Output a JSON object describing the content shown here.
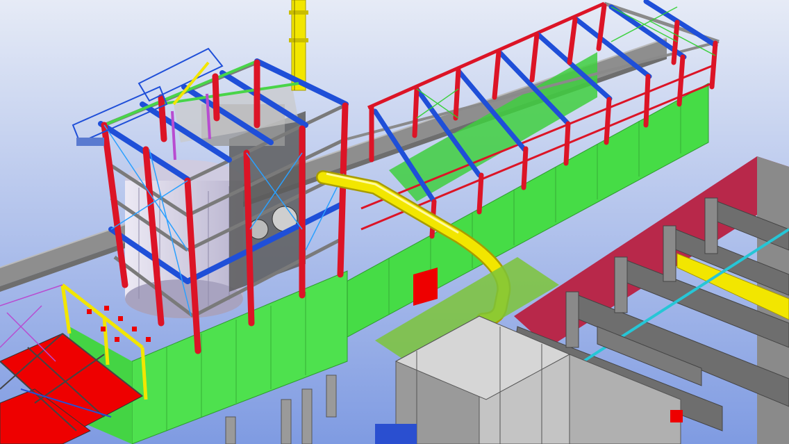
{
  "viewport": {
    "kind": "3D structural steel model view",
    "colors": {
      "sky_top": "#e6ebf6",
      "sky_bottom": "#7f9be2",
      "column": "#dc1426",
      "beam": "#1f4fd8",
      "cladding": "#47dc47",
      "duct": "#f2e600",
      "steel": "#8c8c8c",
      "roof_panel": "#b8284a",
      "deck": "#ee0000",
      "bracing": "#2aa0ff",
      "tank": "#d6d2e8"
    },
    "icons": [
      "column-icon",
      "beam-icon",
      "bracing-icon",
      "cladding-panel-icon",
      "duct-pipe-icon",
      "stair-icon",
      "silo-tank-icon",
      "platform-deck-icon"
    ]
  }
}
